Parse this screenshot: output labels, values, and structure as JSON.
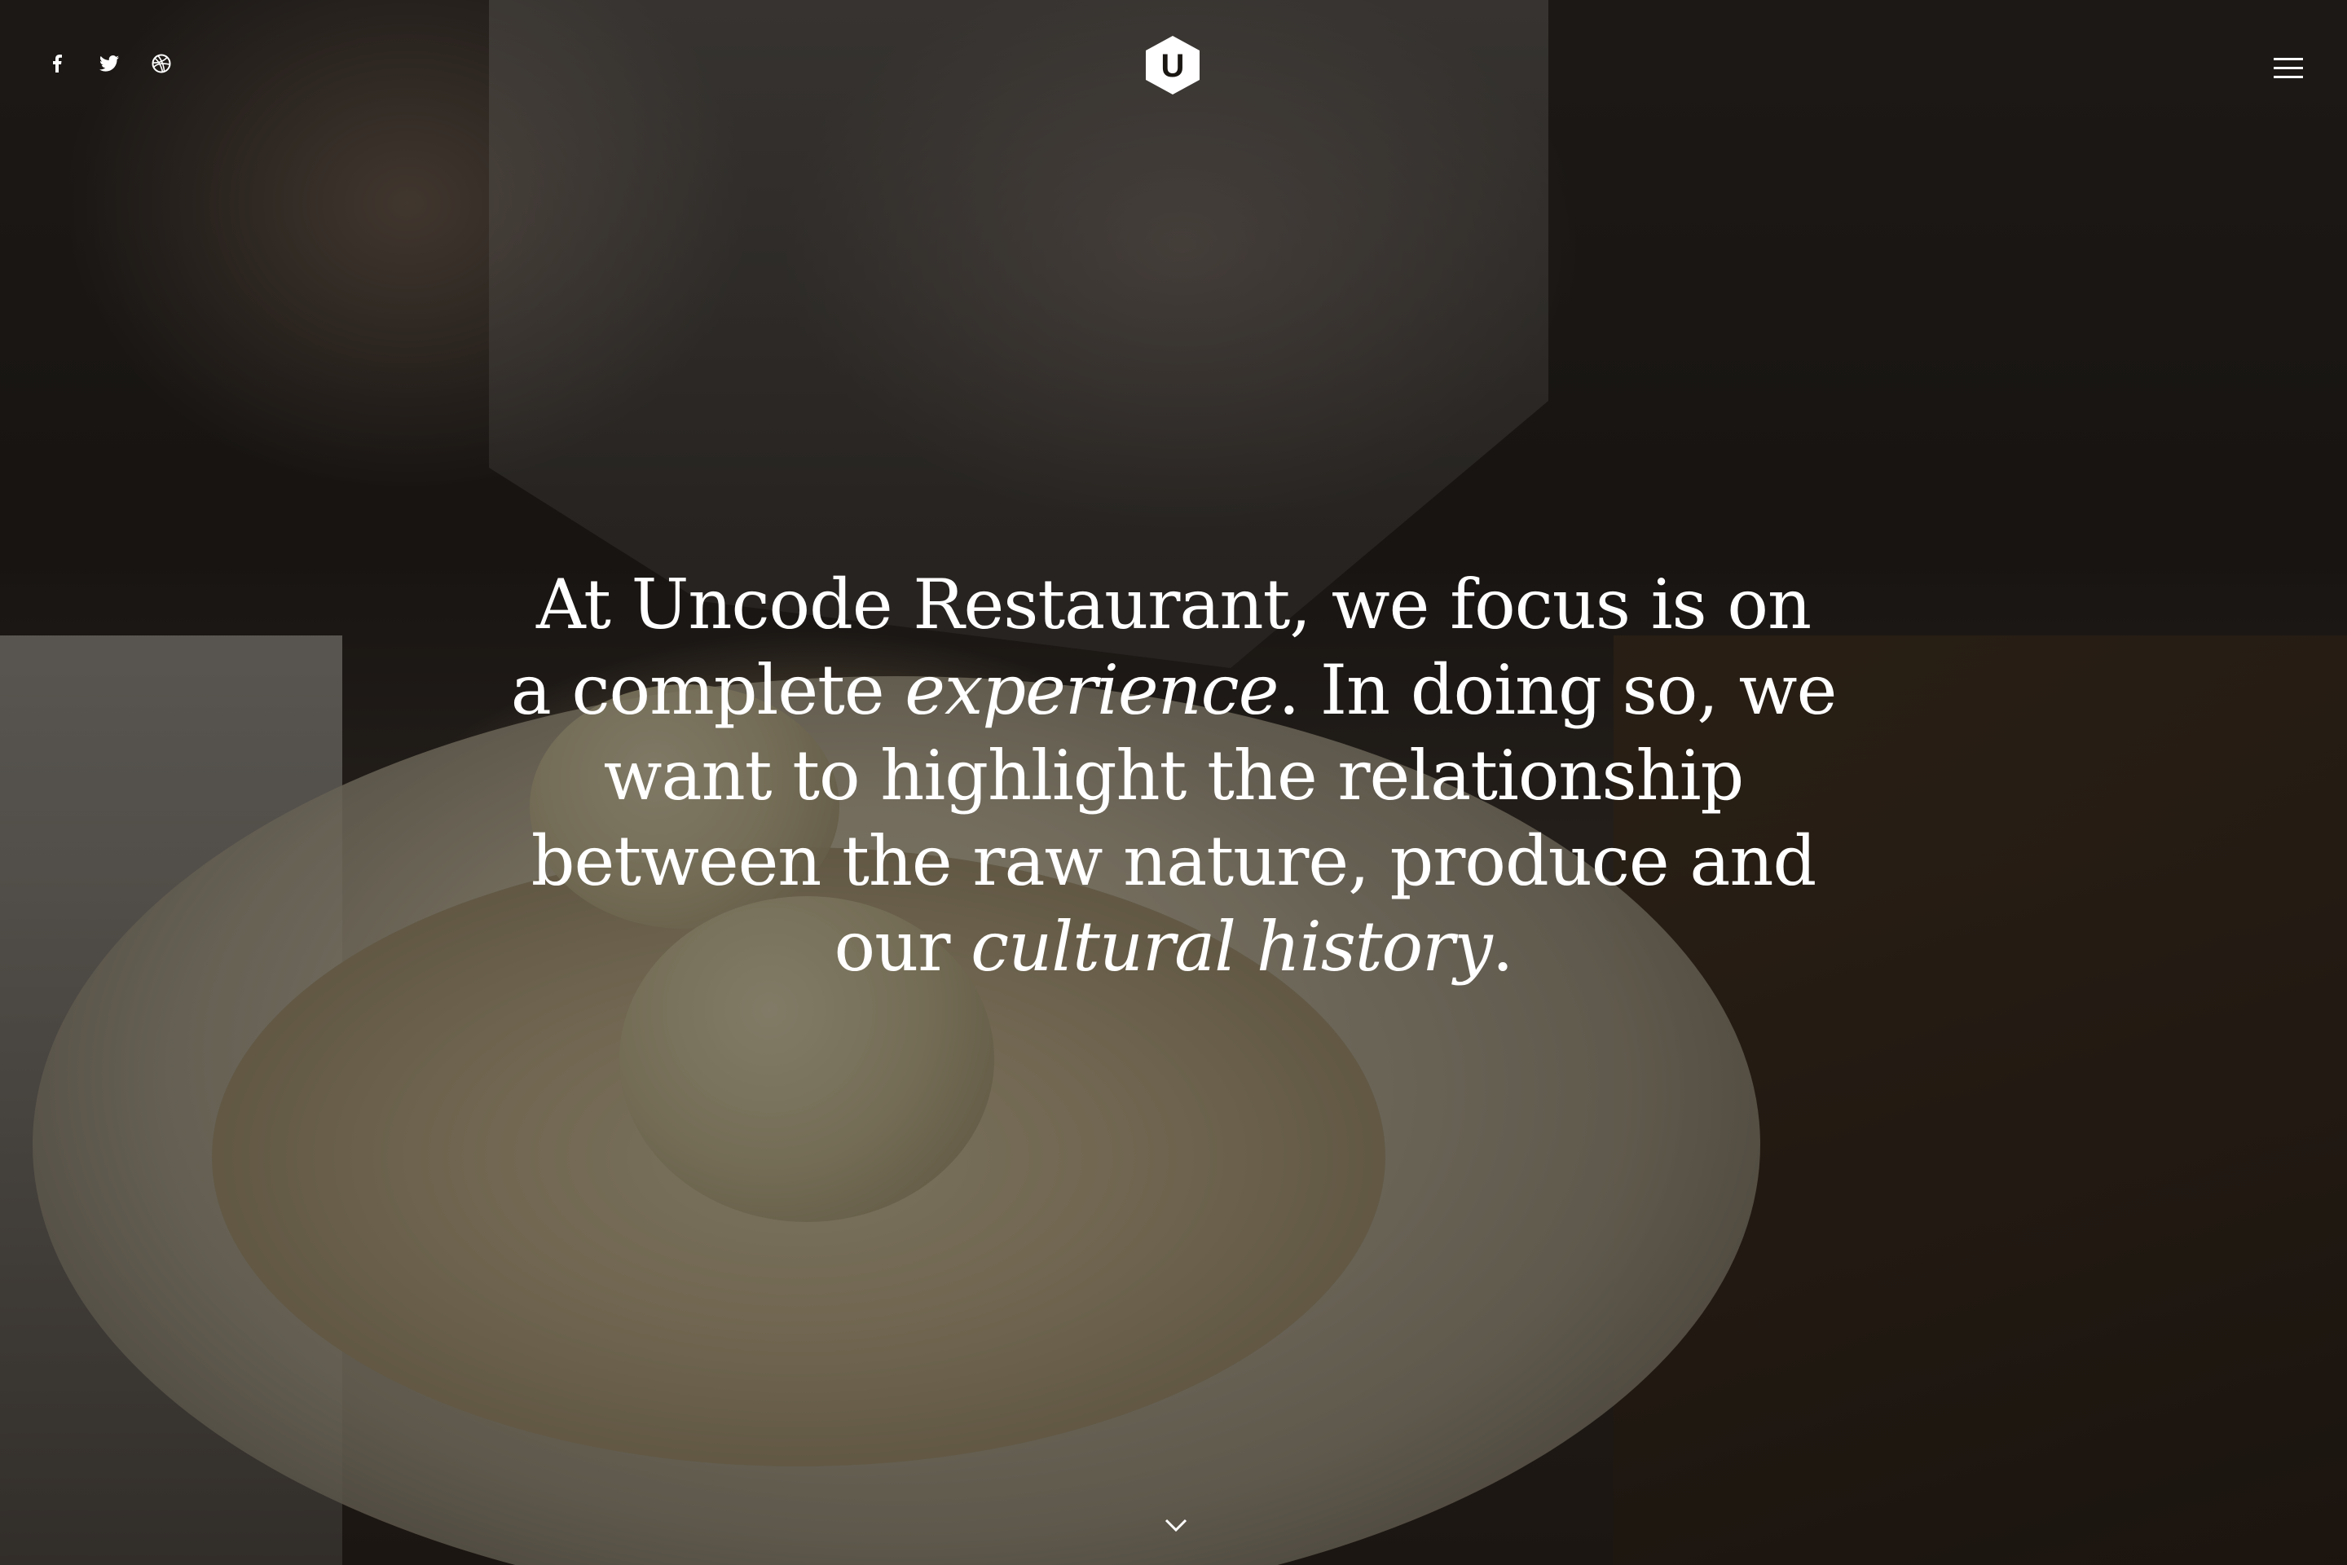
{
  "header": {
    "social": [
      {
        "name": "facebook",
        "icon": "facebook-icon"
      },
      {
        "name": "twitter",
        "icon": "twitter-icon"
      },
      {
        "name": "dribbble",
        "icon": "dribbble-icon"
      }
    ],
    "logo_letter": "U",
    "menu_icon": "hamburger-menu-icon"
  },
  "hero": {
    "line1": "At Uncode Restaurant, we focus is on",
    "line2_a": "a complete ",
    "line2_em": "experience",
    "line2_b": ". In doing so, we",
    "line3": "want to highlight the relationship",
    "line4": "between the raw nature, produce and",
    "line5_a": "our ",
    "line5_em": "cultural history",
    "line5_b": "."
  },
  "scroll": {
    "icon": "chevron-down-icon"
  },
  "colors": {
    "text": "#ffffff",
    "overlay": "#0c0a0a"
  }
}
